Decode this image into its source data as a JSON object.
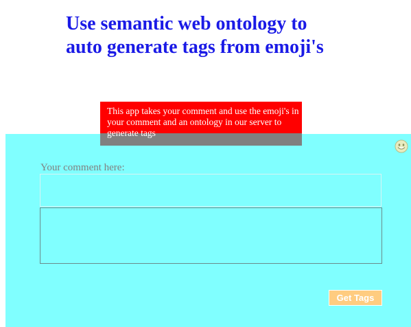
{
  "header": {
    "title": "Use semantic web ontology to auto generate tags from emoji's"
  },
  "description": {
    "text": "This app takes your comment and use the emoji's in your comment and an ontology in our server to generate tags"
  },
  "form": {
    "comment_label": "Your comment here:",
    "comment_value": "",
    "comment_details_value": "",
    "submit_label": "Get Tags"
  },
  "icons": {
    "emoji_picker": "smiley-face-icon"
  },
  "colors": {
    "title": "#1a1ae6",
    "panel_background": "#80ffff",
    "description_background": "#ff0000",
    "description_overflow_band": "#808080",
    "button_background": "#ffcc80",
    "label_text": "#808080"
  }
}
